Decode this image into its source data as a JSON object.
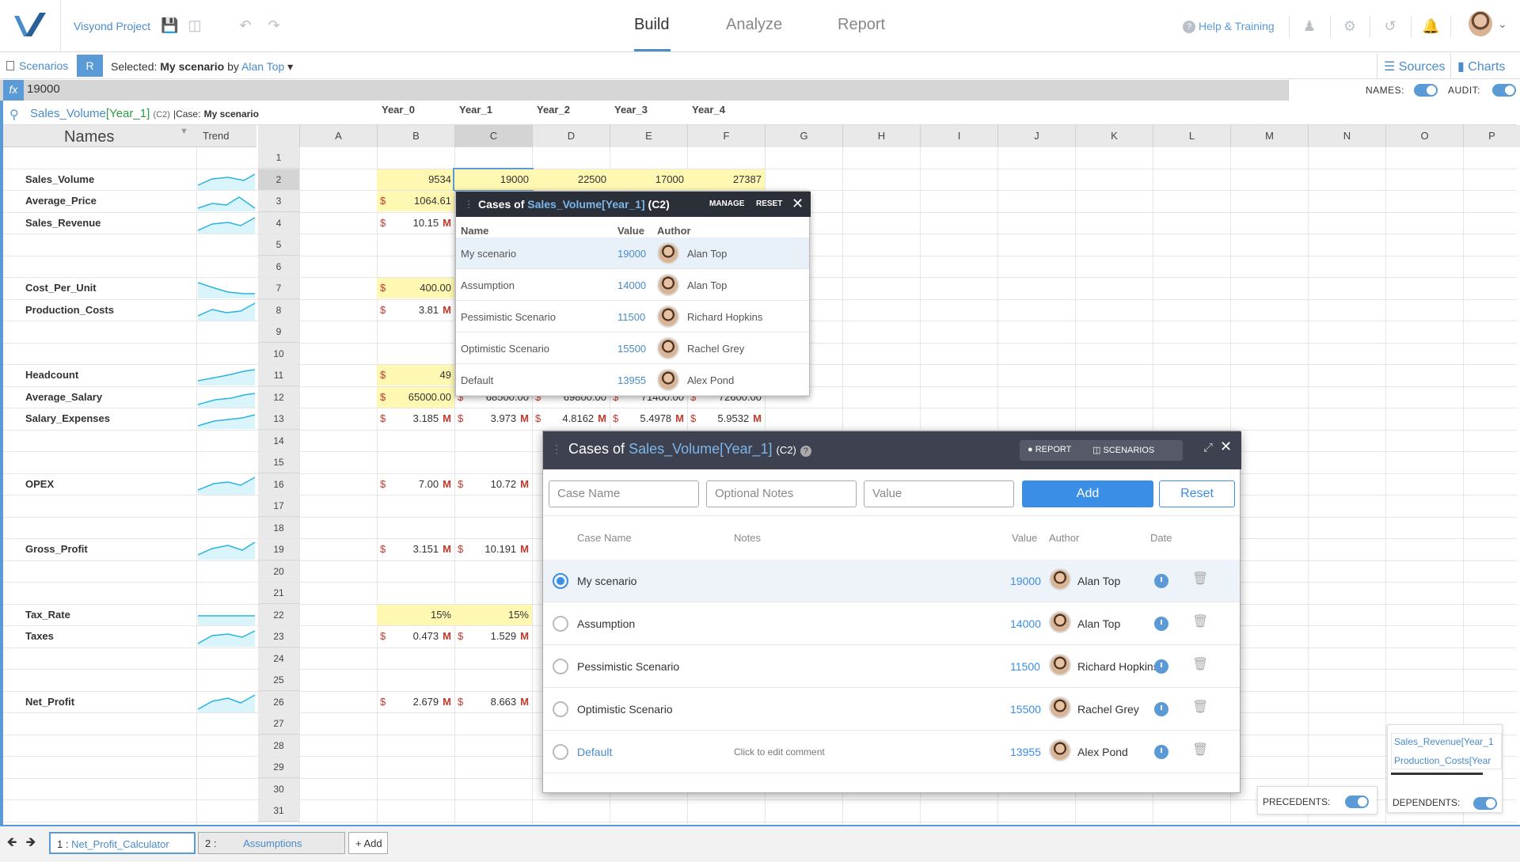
{
  "app": {
    "project_name": "Visyond Project",
    "nav_tabs": [
      "Build",
      "Analyze",
      "Report"
    ],
    "help_label": "Help & Training"
  },
  "toolbar": {
    "scenarios_label": "Scenarios",
    "r_badge": "R",
    "selected_prefix": "Selected:",
    "selected_scenario": "My scenario",
    "by": "by",
    "selected_author": "Alan Top",
    "sources_label": "Sources",
    "charts_label": "Charts"
  },
  "formula_bar": {
    "fx": "fx",
    "value": "19000",
    "names_label": "NAMES:",
    "audit_label": "AUDIT:"
  },
  "grid": {
    "cell_ref": {
      "var": "Sales_Volume",
      "index": "[Year_1]",
      "addr": "(C2)",
      "case_prefix": "|Case:",
      "case_name": "My scenario"
    },
    "names_header": "Names",
    "trend_header": "Trend",
    "year_headers": [
      "Year_0",
      "Year_1",
      "Year_2",
      "Year_3",
      "Year_4"
    ],
    "columns": [
      "A",
      "B",
      "C",
      "D",
      "E",
      "F",
      "G",
      "H",
      "I",
      "J",
      "K",
      "L",
      "M",
      "N",
      "O",
      "P"
    ],
    "row_numbers": [
      "1",
      "2",
      "3",
      "4",
      "5",
      "6",
      "7",
      "8",
      "9",
      "10",
      "11",
      "12",
      "13",
      "14",
      "15",
      "16",
      "17",
      "18",
      "19",
      "20",
      "21",
      "22",
      "23",
      "24",
      "25",
      "26",
      "27",
      "28",
      "29",
      "30",
      "31"
    ],
    "rows": [
      {
        "row": 2,
        "label": "Sales_Volume",
        "cells": [
          "9534",
          "19000",
          "22500",
          "17000",
          "27387"
        ]
      },
      {
        "row": 3,
        "label": "Average_Price",
        "cells": [
          "1064.61"
        ]
      },
      {
        "row": 4,
        "label": "Sales_Revenue",
        "cells": [
          "10.15"
        ]
      },
      {
        "row": 7,
        "label": "Cost_Per_Unit",
        "cells": [
          "400.00"
        ]
      },
      {
        "row": 8,
        "label": "Production_Costs",
        "cells": [
          "3.81"
        ]
      },
      {
        "row": 11,
        "label": "Headcount",
        "cells": [
          "49"
        ]
      },
      {
        "row": 12,
        "label": "Average_Salary",
        "cells": [
          "65000.00",
          "68500.00",
          "69800.00",
          "71400.00",
          "72600.00"
        ]
      },
      {
        "row": 13,
        "label": "Salary_Expenses",
        "cells": [
          "3.185",
          "3.973",
          "4.8162",
          "5.4978",
          "5.9532"
        ]
      },
      {
        "row": 16,
        "label": "OPEX",
        "cells": [
          "7.00",
          "10.72"
        ]
      },
      {
        "row": 19,
        "label": "Gross_Profit",
        "cells": [
          "3.151",
          "10.191"
        ]
      },
      {
        "row": 22,
        "label": "Tax_Rate",
        "cells": [
          "15%",
          "15%"
        ]
      },
      {
        "row": 23,
        "label": "Taxes",
        "cells": [
          "0.473",
          "1.529"
        ]
      },
      {
        "row": 26,
        "label": "Net_Profit",
        "cells": [
          "2.679",
          "8.663"
        ]
      }
    ],
    "dollar": "$",
    "million": "M"
  },
  "cases_popup_small": {
    "title_prefix": "Cases of",
    "var": "Sales_Volume[Year_1]",
    "addr": "(C2)",
    "manage": "MANAGE",
    "reset": "RESET",
    "col_name": "Name",
    "col_value": "Value",
    "col_author": "Author",
    "items": [
      {
        "name": "My scenario",
        "value": "19000",
        "author": "Alan Top"
      },
      {
        "name": "Assumption",
        "value": "14000",
        "author": "Alan Top"
      },
      {
        "name": "Pessimistic Scenario",
        "value": "11500",
        "author": "Richard Hopkins"
      },
      {
        "name": "Optimistic Scenario",
        "value": "15500",
        "author": "Rachel Grey"
      },
      {
        "name": "Default",
        "value": "13955",
        "author": "Alex Pond"
      }
    ]
  },
  "cases_popup_large": {
    "title_prefix": "Cases of",
    "var": "Sales_Volume[Year_1]",
    "addr": "(C2)",
    "report_btn": "REPORT",
    "scenarios_btn": "SCENARIOS",
    "case_name_placeholder": "Case Name",
    "notes_placeholder": "Optional Notes",
    "value_placeholder": "Value",
    "add_label": "Add",
    "reset_label": "Reset",
    "col_case": "Case Name",
    "col_notes": "Notes",
    "col_value": "Value",
    "col_author": "Author",
    "col_date": "Date",
    "items": [
      {
        "name": "My scenario",
        "notes": "",
        "value": "19000",
        "author": "Alan Top"
      },
      {
        "name": "Assumption",
        "notes": "",
        "value": "14000",
        "author": "Alan Top"
      },
      {
        "name": "Pessimistic Scenario",
        "notes": "",
        "value": "11500",
        "author": "Richard Hopkins"
      },
      {
        "name": "Optimistic Scenario",
        "notes": "",
        "value": "15500",
        "author": "Rachel Grey"
      },
      {
        "name": "Default",
        "notes": "Click to edit comment",
        "value": "13955",
        "author": "Alex Pond"
      }
    ]
  },
  "audit": {
    "dependents": [
      "Sales_Revenue[Year_1",
      "Production_Costs[Year"
    ],
    "precedents_label": "PRECEDENTS:",
    "dependents_label": "DEPENDENTS:"
  },
  "sheets": {
    "tabs": [
      {
        "num": "1 :",
        "name": "Net_Profit_Calculator"
      },
      {
        "num": "2 :",
        "name": "Assumptions"
      }
    ],
    "add_label": "+ Add"
  },
  "colors": {
    "accent": "#4a8bc9",
    "highlight": "#fff8b3",
    "dark_header": "#3e4150"
  }
}
